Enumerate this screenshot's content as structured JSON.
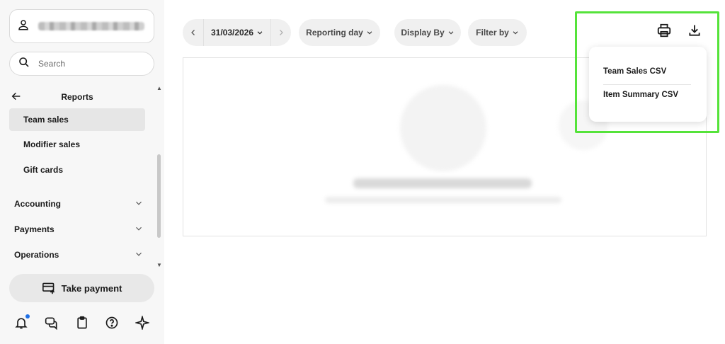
{
  "sidebar": {
    "search": {
      "placeholder": "Search"
    },
    "nav_title": "Reports",
    "items": [
      {
        "label": "Team sales",
        "active": true
      },
      {
        "label": "Modifier sales",
        "active": false
      },
      {
        "label": "Gift cards",
        "active": false
      }
    ],
    "sections": [
      {
        "label": "Accounting"
      },
      {
        "label": "Payments"
      },
      {
        "label": "Operations"
      }
    ],
    "take_payment_label": "Take payment",
    "bottom_icons": [
      "bell-icon",
      "chat-icon",
      "clipboard-icon",
      "help-icon",
      "sparkle-icon"
    ],
    "notification_dot_color": "#1f6fe5"
  },
  "toolbar": {
    "date": "31/03/2026",
    "reporting_day_label": "Reporting day",
    "display_by_label": "Display By",
    "filter_by_label": "Filter by",
    "print_icon": "print-icon",
    "download_icon": "download-icon"
  },
  "export_menu": {
    "items": [
      {
        "label": "Team Sales CSV"
      },
      {
        "label": "Item Summary CSV"
      }
    ]
  },
  "colors": {
    "highlight": "#55e33a",
    "pill_bg": "#f0f0f0",
    "sidebar_bg": "#f7f7f7"
  }
}
